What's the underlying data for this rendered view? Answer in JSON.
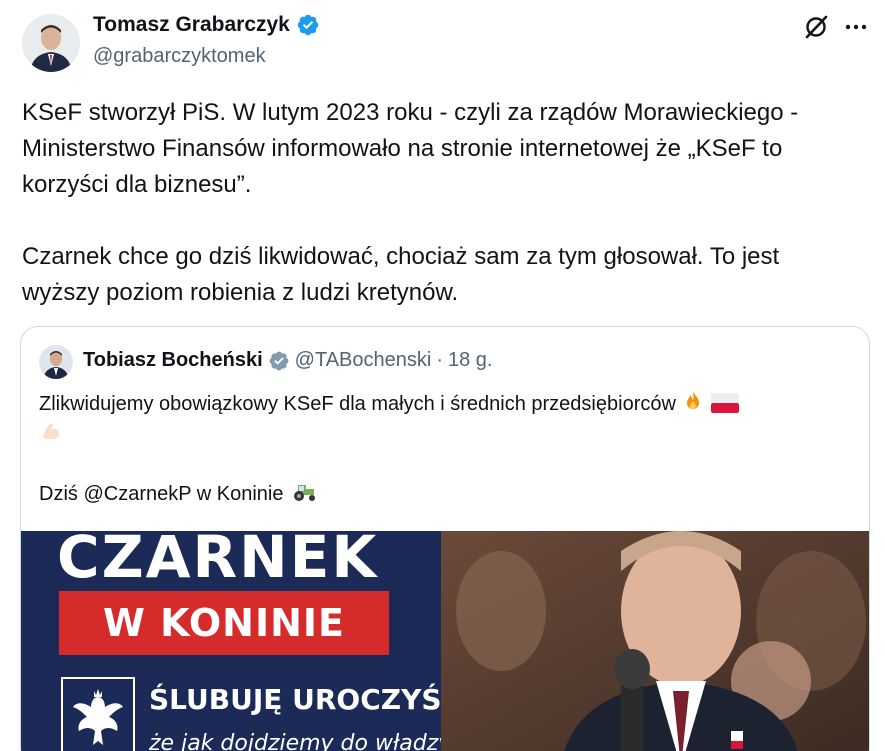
{
  "author": {
    "name": "Tomasz Grabarczyk",
    "handle": "@grabarczyktomek"
  },
  "tweet": {
    "lines_p1": [
      "KSeF stworzył PiS. W lutym 2023 roku - czyli za rządów Morawieckiego -",
      "Ministerstwo Finansów informowało na stronie internetowej że „KSeF to",
      "korzyści dla biznesu”."
    ],
    "lines_p2": [
      "Czarnek chce go dziś likwidować, chociaż sam za tym głosował. To jest",
      "wyższy poziom robienia z ludzi kretynów."
    ]
  },
  "quote": {
    "name": "Tobiasz Bocheński",
    "handle": "@TABochenski",
    "separator": "·",
    "time": "18 g.",
    "line1": "Zlikwidujemy obowiązkowy KSeF dla małych i średnich przedsiębiorców",
    "line2": "Dziś @CzarnekP w Koninie",
    "media": {
      "title": "CZARNEK",
      "banner": "W KONINIE",
      "pledge": "ŚLUBUJĘ UROCZYŚCIE,",
      "subtitle": "że jak dojdziemy do władzy"
    }
  },
  "icons": {
    "verified": "verified-badge-icon",
    "grok": "grok-icon",
    "more": "more-icon"
  },
  "colors": {
    "accent": "#1d9bf0",
    "gray_verified": "#829aab",
    "text": "#0f1419",
    "muted": "#536471"
  }
}
